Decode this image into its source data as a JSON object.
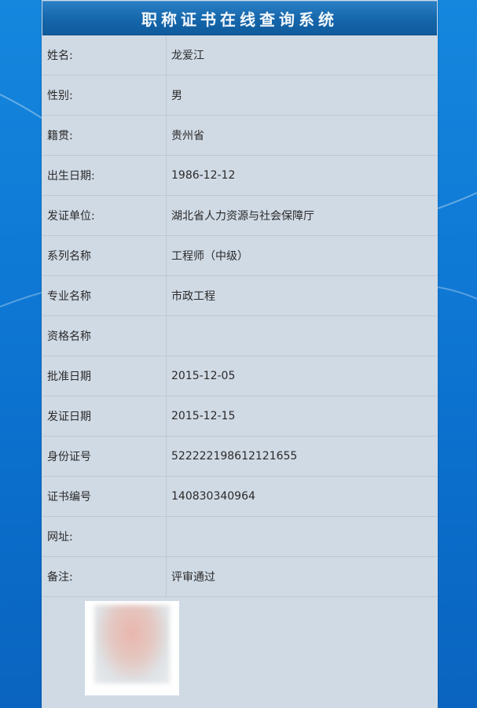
{
  "header": {
    "title": "职称证书在线查询系统"
  },
  "rows": [
    {
      "label": "姓名:",
      "value": "龙爱江"
    },
    {
      "label": "性别:",
      "value": "男"
    },
    {
      "label": "籍贯:",
      "value": "贵州省"
    },
    {
      "label": "出生日期:",
      "value": "1986-12-12"
    },
    {
      "label": "发证单位:",
      "value": "湖北省人力资源与社会保障厅"
    },
    {
      "label": "系列名称",
      "value": "工程师（中级）"
    },
    {
      "label": "专业名称",
      "value": "市政工程"
    },
    {
      "label": "资格名称",
      "value": ""
    },
    {
      "label": "批准日期",
      "value": "2015-12-05"
    },
    {
      "label": "发证日期",
      "value": "2015-12-15"
    },
    {
      "label": "身份证号",
      "value": "522222198612121655"
    },
    {
      "label": "证书编号",
      "value": "140830340964"
    },
    {
      "label": "网址:",
      "value": ""
    },
    {
      "label": "备注:",
      "value": "评审通过"
    }
  ],
  "colors": {
    "background": "#0f7ad6",
    "panel": "#d0dae5",
    "header": "#1566ab",
    "header_text": "#f3f7fb",
    "row_border": "#bcc8d4"
  }
}
